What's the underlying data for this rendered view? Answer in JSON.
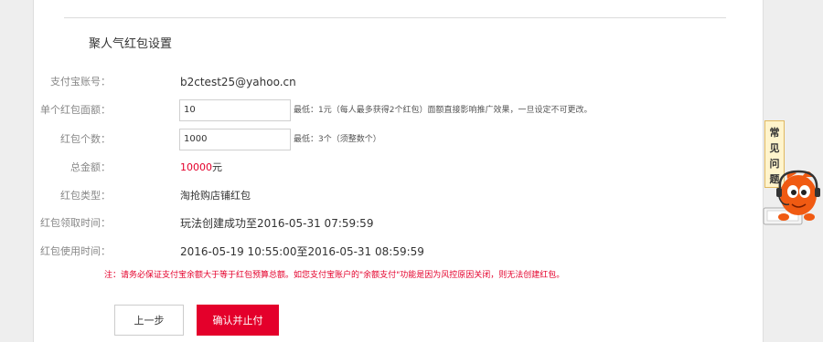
{
  "section_title": "聚人气红包设置",
  "fields": {
    "alipay_account": {
      "label": "支付宝账号：",
      "value": "b2ctest25@yahoo.cn"
    },
    "single_amount": {
      "label": "单个红包面额：",
      "value": "10",
      "hint": "最低：1元（每人最多获得2个红包）面额直接影响推广效果，一旦设定不可更改。"
    },
    "count": {
      "label": "红包个数：",
      "value": "1000",
      "hint": "最低：3个（须整数个）"
    },
    "total": {
      "label": "总金额：",
      "value": "10000",
      "unit": "元"
    },
    "type": {
      "label": "红包类型：",
      "value": "淘抢购店铺红包"
    },
    "claim_time": {
      "label": "红包领取时间：",
      "value": "玩法创建成功至2016-05-31 07:59:59"
    },
    "use_time": {
      "label": "红包使用时间：",
      "value": "2016-05-19 10:55:00至2016-05-31 08:59:59"
    }
  },
  "note": "注：请务必保证支付宝余额大于等于红包预算总额。如您支付宝账户的\"余额支付\"功能是因为风控原因关闭，则无法创建红包。",
  "buttons": {
    "prev": "上一步",
    "confirm": "确认并止付"
  },
  "faq": {
    "chars": [
      "常",
      "见",
      "问",
      "题"
    ]
  },
  "colors": {
    "accent": "#e4002b",
    "faq_bg": "#fff4cc",
    "mascot": "#f05a12"
  }
}
